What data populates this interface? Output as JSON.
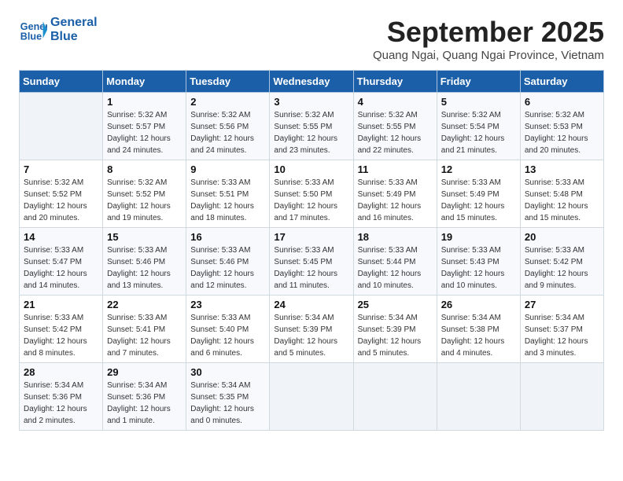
{
  "header": {
    "logo_line1": "General",
    "logo_line2": "Blue",
    "month": "September 2025",
    "location": "Quang Ngai, Quang Ngai Province, Vietnam"
  },
  "weekdays": [
    "Sunday",
    "Monday",
    "Tuesday",
    "Wednesday",
    "Thursday",
    "Friday",
    "Saturday"
  ],
  "weeks": [
    [
      {
        "day": "",
        "info": ""
      },
      {
        "day": "1",
        "info": "Sunrise: 5:32 AM\nSunset: 5:57 PM\nDaylight: 12 hours\nand 24 minutes."
      },
      {
        "day": "2",
        "info": "Sunrise: 5:32 AM\nSunset: 5:56 PM\nDaylight: 12 hours\nand 24 minutes."
      },
      {
        "day": "3",
        "info": "Sunrise: 5:32 AM\nSunset: 5:55 PM\nDaylight: 12 hours\nand 23 minutes."
      },
      {
        "day": "4",
        "info": "Sunrise: 5:32 AM\nSunset: 5:55 PM\nDaylight: 12 hours\nand 22 minutes."
      },
      {
        "day": "5",
        "info": "Sunrise: 5:32 AM\nSunset: 5:54 PM\nDaylight: 12 hours\nand 21 minutes."
      },
      {
        "day": "6",
        "info": "Sunrise: 5:32 AM\nSunset: 5:53 PM\nDaylight: 12 hours\nand 20 minutes."
      }
    ],
    [
      {
        "day": "7",
        "info": "Sunrise: 5:32 AM\nSunset: 5:52 PM\nDaylight: 12 hours\nand 20 minutes."
      },
      {
        "day": "8",
        "info": "Sunrise: 5:32 AM\nSunset: 5:52 PM\nDaylight: 12 hours\nand 19 minutes."
      },
      {
        "day": "9",
        "info": "Sunrise: 5:33 AM\nSunset: 5:51 PM\nDaylight: 12 hours\nand 18 minutes."
      },
      {
        "day": "10",
        "info": "Sunrise: 5:33 AM\nSunset: 5:50 PM\nDaylight: 12 hours\nand 17 minutes."
      },
      {
        "day": "11",
        "info": "Sunrise: 5:33 AM\nSunset: 5:49 PM\nDaylight: 12 hours\nand 16 minutes."
      },
      {
        "day": "12",
        "info": "Sunrise: 5:33 AM\nSunset: 5:49 PM\nDaylight: 12 hours\nand 15 minutes."
      },
      {
        "day": "13",
        "info": "Sunrise: 5:33 AM\nSunset: 5:48 PM\nDaylight: 12 hours\nand 15 minutes."
      }
    ],
    [
      {
        "day": "14",
        "info": "Sunrise: 5:33 AM\nSunset: 5:47 PM\nDaylight: 12 hours\nand 14 minutes."
      },
      {
        "day": "15",
        "info": "Sunrise: 5:33 AM\nSunset: 5:46 PM\nDaylight: 12 hours\nand 13 minutes."
      },
      {
        "day": "16",
        "info": "Sunrise: 5:33 AM\nSunset: 5:46 PM\nDaylight: 12 hours\nand 12 minutes."
      },
      {
        "day": "17",
        "info": "Sunrise: 5:33 AM\nSunset: 5:45 PM\nDaylight: 12 hours\nand 11 minutes."
      },
      {
        "day": "18",
        "info": "Sunrise: 5:33 AM\nSunset: 5:44 PM\nDaylight: 12 hours\nand 10 minutes."
      },
      {
        "day": "19",
        "info": "Sunrise: 5:33 AM\nSunset: 5:43 PM\nDaylight: 12 hours\nand 10 minutes."
      },
      {
        "day": "20",
        "info": "Sunrise: 5:33 AM\nSunset: 5:42 PM\nDaylight: 12 hours\nand 9 minutes."
      }
    ],
    [
      {
        "day": "21",
        "info": "Sunrise: 5:33 AM\nSunset: 5:42 PM\nDaylight: 12 hours\nand 8 minutes."
      },
      {
        "day": "22",
        "info": "Sunrise: 5:33 AM\nSunset: 5:41 PM\nDaylight: 12 hours\nand 7 minutes."
      },
      {
        "day": "23",
        "info": "Sunrise: 5:33 AM\nSunset: 5:40 PM\nDaylight: 12 hours\nand 6 minutes."
      },
      {
        "day": "24",
        "info": "Sunrise: 5:34 AM\nSunset: 5:39 PM\nDaylight: 12 hours\nand 5 minutes."
      },
      {
        "day": "25",
        "info": "Sunrise: 5:34 AM\nSunset: 5:39 PM\nDaylight: 12 hours\nand 5 minutes."
      },
      {
        "day": "26",
        "info": "Sunrise: 5:34 AM\nSunset: 5:38 PM\nDaylight: 12 hours\nand 4 minutes."
      },
      {
        "day": "27",
        "info": "Sunrise: 5:34 AM\nSunset: 5:37 PM\nDaylight: 12 hours\nand 3 minutes."
      }
    ],
    [
      {
        "day": "28",
        "info": "Sunrise: 5:34 AM\nSunset: 5:36 PM\nDaylight: 12 hours\nand 2 minutes."
      },
      {
        "day": "29",
        "info": "Sunrise: 5:34 AM\nSunset: 5:36 PM\nDaylight: 12 hours\nand 1 minute."
      },
      {
        "day": "30",
        "info": "Sunrise: 5:34 AM\nSunset: 5:35 PM\nDaylight: 12 hours\nand 0 minutes."
      },
      {
        "day": "",
        "info": ""
      },
      {
        "day": "",
        "info": ""
      },
      {
        "day": "",
        "info": ""
      },
      {
        "day": "",
        "info": ""
      }
    ]
  ]
}
